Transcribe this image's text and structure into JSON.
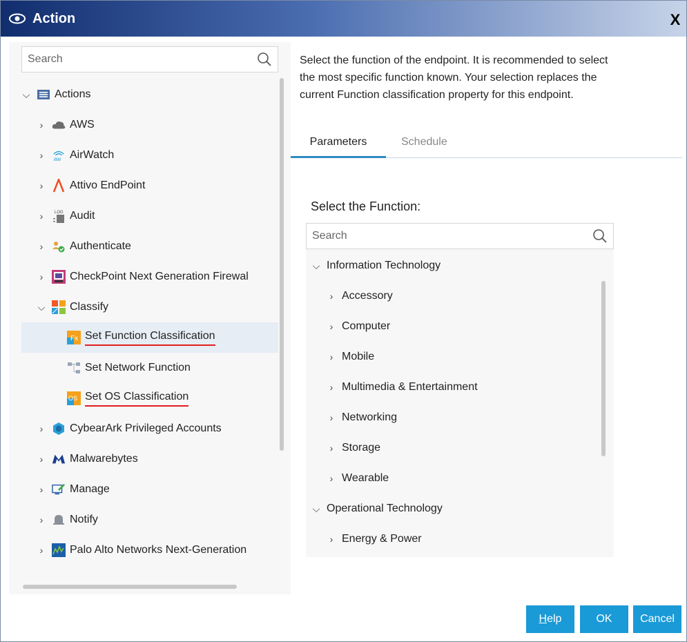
{
  "window": {
    "title": "Action",
    "close_label": "X"
  },
  "left_panel": {
    "search_placeholder": "Search",
    "tree": [
      {
        "label": "Actions",
        "level": 0,
        "expanded": true,
        "icon": "list-icon"
      },
      {
        "label": "AWS",
        "level": 1,
        "expanded": false,
        "icon": "cloud-icon"
      },
      {
        "label": "AirWatch",
        "level": 1,
        "expanded": false,
        "icon": "airwatch-icon"
      },
      {
        "label": "Attivo EndPoint",
        "level": 1,
        "expanded": false,
        "icon": "attivo-icon"
      },
      {
        "label": "Audit",
        "level": 1,
        "expanded": false,
        "icon": "log-icon"
      },
      {
        "label": "Authenticate",
        "level": 1,
        "expanded": false,
        "icon": "user-check-icon"
      },
      {
        "label": "CheckPoint Next Generation Firewal",
        "level": 1,
        "expanded": false,
        "icon": "checkpoint-icon"
      },
      {
        "label": "Classify",
        "level": 1,
        "expanded": true,
        "icon": "classify-icon"
      },
      {
        "label": "Set Function Classification",
        "level": 2,
        "selected": true,
        "underlined": true,
        "icon": "function-classification-icon"
      },
      {
        "label": "Set Network Function",
        "level": 2,
        "icon": "network-function-icon"
      },
      {
        "label": "Set OS Classification",
        "level": 2,
        "underlined": true,
        "icon": "os-classification-icon"
      },
      {
        "label": "CybearArk Privileged Accounts",
        "level": 1,
        "expanded": false,
        "icon": "cyberark-icon"
      },
      {
        "label": "Malwarebytes",
        "level": 1,
        "expanded": false,
        "icon": "malwarebytes-icon"
      },
      {
        "label": "Manage",
        "level": 1,
        "expanded": false,
        "icon": "manage-icon"
      },
      {
        "label": "Notify",
        "level": 1,
        "expanded": false,
        "icon": "bell-icon"
      },
      {
        "label": "Palo Alto Networks Next-Generation",
        "level": 1,
        "expanded": false,
        "icon": "paloalto-icon"
      }
    ]
  },
  "right_panel": {
    "description": "Select the function of the endpoint. It is recommended to select the most specific function known. Your selection replaces the current Function classification property for this endpoint.",
    "description_lines": [
      "Select the function of the endpoint. It is recommended to select",
      "the most specific function known. Your selection replaces the",
      "current Function classification property for this endpoint."
    ],
    "tabs": [
      {
        "label": "Parameters",
        "active": true
      },
      {
        "label": "Schedule",
        "active": false
      }
    ],
    "function_label": "Select the Function:",
    "function_search_placeholder": "Search",
    "function_tree": [
      {
        "label": "Information Technology",
        "level": 0,
        "expanded": true
      },
      {
        "label": "Accessory",
        "level": 1
      },
      {
        "label": "Computer",
        "level": 1
      },
      {
        "label": "Mobile",
        "level": 1
      },
      {
        "label": "Multimedia & Entertainment",
        "level": 1
      },
      {
        "label": "Networking",
        "level": 1
      },
      {
        "label": "Storage",
        "level": 1
      },
      {
        "label": "Wearable",
        "level": 1
      },
      {
        "label": "Operational Technology",
        "level": 0,
        "expanded": true
      },
      {
        "label": "Energy & Power",
        "level": 1
      }
    ]
  },
  "buttons": {
    "help_label_underlined": "H",
    "help_label_rest": "elp",
    "ok_label": "OK",
    "cancel_label": "Cancel"
  },
  "colors": {
    "title_gradient_start": "#112d6e",
    "button_blue": "#1a9ad6",
    "tab_active_underline": "#2e8bc0",
    "selection_underline": "#e21d1d",
    "selected_row_bg": "#e6edf4"
  }
}
